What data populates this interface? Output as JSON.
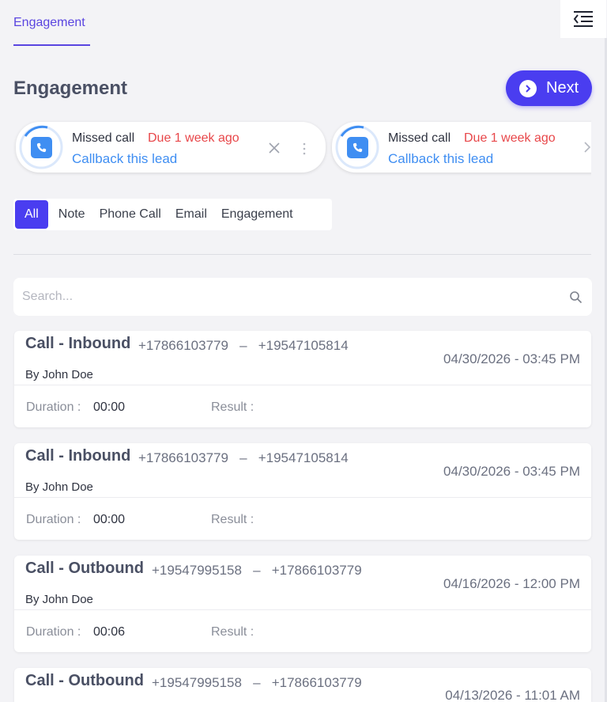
{
  "nav": {
    "tab_label": "Engagement"
  },
  "header": {
    "title": "Engagement",
    "next_label": "Next"
  },
  "tasks": [
    {
      "type": "Missed call",
      "due": "Due 1 week ago",
      "action": "Callback this lead"
    },
    {
      "type": "Missed call",
      "due": "Due 1 week ago",
      "action": "Callback this lead"
    }
  ],
  "filters": [
    "All",
    "Note",
    "Phone Call",
    "Email",
    "Engagement"
  ],
  "active_filter": "All",
  "search": {
    "placeholder": "Search..."
  },
  "labels": {
    "duration": "Duration :",
    "result": "Result :"
  },
  "engagements": [
    {
      "title": "Call - Inbound",
      "phones": "+17866103779   –   +19547105814",
      "date": "04/30/2026 - 03:45 PM",
      "by": "By John Doe",
      "duration": "00:00",
      "result": ""
    },
    {
      "title": "Call - Inbound",
      "phones": "+17866103779   –   +19547105814",
      "date": "04/30/2026 - 03:45 PM",
      "by": "By John Doe",
      "duration": "00:00",
      "result": ""
    },
    {
      "title": "Call - Outbound",
      "phones": "+19547995158   –   +17866103779",
      "date": "04/16/2026 - 12:00 PM",
      "by": "By John Doe",
      "duration": "00:06",
      "result": ""
    },
    {
      "title": "Call - Outbound",
      "phones": "+19547995158   –   +17866103779",
      "date": "04/13/2026 - 11:01 AM",
      "by": "By John Doe",
      "duration": "",
      "result": ""
    }
  ],
  "colors": {
    "accent": "#4a3df0",
    "link": "#3f8ef2",
    "due": "#e8474a"
  },
  "icons": [
    "menu-collapse-icon",
    "play-circle-icon",
    "phone-icon",
    "close-icon",
    "more-vertical-icon",
    "chevron-right-icon",
    "search-icon"
  ]
}
